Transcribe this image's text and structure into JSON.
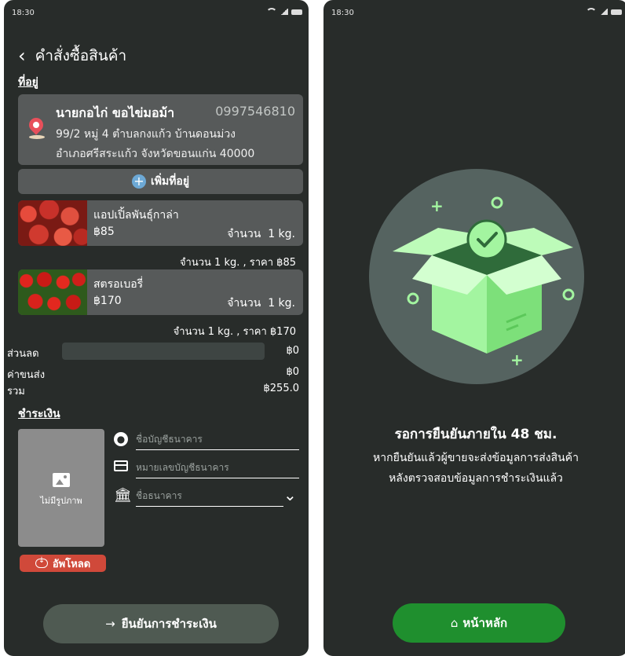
{
  "status_bar": {
    "time": "18:30"
  },
  "order": {
    "title": "คำสั่งซื้อสินค้า",
    "address_section": "ที่อยู่",
    "address": {
      "name": "นายกอไก่  ขอไข่มอม้า",
      "phone": "0997546810",
      "line1": "99/2 หมู่ 4 ตำบลกงแก้ว บ้านดอนม่วง",
      "line2": "อำเภอศรีสระแก้ว จังหวัดขอนแก่น 40000"
    },
    "add_address_label": "เพิ่มที่อยู่",
    "products": [
      {
        "name": "แอปเปิ้ลพันธุ์กาล่า",
        "price": "฿85",
        "qty_label": "จำนวน",
        "qty": "1 kg.",
        "summary": "จำนวน    1 kg. , ราคา    ฿85"
      },
      {
        "name": "สตรอเบอรี่",
        "price": "฿170",
        "qty_label": "จำนวน",
        "qty": "1 kg.",
        "summary": "จำนวน    1 kg. , ราคา   ฿170"
      }
    ],
    "discount_label": "ส่วนลด",
    "discount_value": "฿0",
    "shipping_label": "ค่าขนส่ง",
    "shipping_value": "฿0",
    "total_label": "รวม",
    "total_value": "฿255.0",
    "payment_section": "ชำระเงิน",
    "no_image_label": "ไม่มีรูปภาพ",
    "upload_label": "อัพโหลด",
    "fields": {
      "account_name_placeholder": "ชื่อบัญชีธนาคาร",
      "account_number_placeholder": "หมายเลขบัญชีธนาคาร",
      "bank_name_placeholder": "ชื่อธนาคาร"
    },
    "confirm_label": "ยืนยันการชำระเงิน",
    "confirm_arrow": "→"
  },
  "success": {
    "title": "รอการยืนยันภายใน 48 ชม.",
    "line1": "หากยืนยันแล้วผู้ขายจะส่งข้อมูลการส่งสินค้า",
    "line2": "หลังตรวจสอบข้อมูลการชำระเงินแล้ว",
    "home_label": "หน้าหลัก"
  },
  "colors": {
    "background": "#282c2a",
    "card": "#575a5a",
    "box_green": "#a3f5a0",
    "confirm_green": "#1f8f2e",
    "upload_red": "#d0493a"
  },
  "icons": [
    "back-chevron-icon",
    "location-pin-icon",
    "plus-circle-icon",
    "image-icon",
    "cloud-upload-icon",
    "user-icon",
    "credit-card-icon",
    "bank-icon",
    "chevron-down-icon",
    "arrow-right-icon",
    "home-icon",
    "box-check-icon"
  ]
}
